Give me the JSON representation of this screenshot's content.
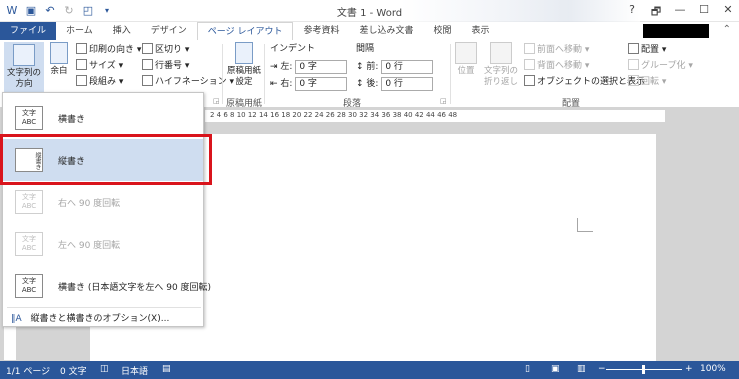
{
  "title": "文書 1 - Word",
  "qat": {
    "save": "保存",
    "undo": "元に戻す",
    "redo": "やり直し"
  },
  "window": {
    "help": "?",
    "restore": "🗗",
    "minimize": "—",
    "maximize": "☐",
    "close": "✕"
  },
  "tabs": [
    "ファイル",
    "ホーム",
    "挿入",
    "デザイン",
    "ページ レイアウト",
    "参考資料",
    "差し込み文書",
    "校閲",
    "表示"
  ],
  "ribbon": {
    "text_direction": "文字列の\n方向",
    "margins": "余白",
    "print_orientation": "印刷の向き",
    "size": "サイズ",
    "columns": "段組み",
    "breaks": "区切り",
    "line_numbers": "行番号",
    "hyphenation": "ハイフネーション",
    "manuscript": "原稿用紙\n設定",
    "manuscript_group": "原稿用紙",
    "indent_label": "インデント",
    "spacing_label": "間隔",
    "indent_left_label": "左:",
    "indent_left_value": "0 字",
    "indent_right_label": "右:",
    "indent_right_value": "0 字",
    "spacing_before_label": "前:",
    "spacing_before_value": "0 行",
    "spacing_after_label": "後:",
    "spacing_after_value": "0 行",
    "paragraph_group": "段落",
    "position": "位置",
    "wrap": "文字列の\n折り返し",
    "bring_forward": "前面へ移動",
    "send_backward": "背面へ移動",
    "selection_pane": "オブジェクトの選択と表示",
    "align": "配置",
    "group": "グループ化",
    "rotate": "回転",
    "arrange_group": "配置"
  },
  "ruler": "2   4   6   8   10  12  14  16  18  20  22  24  26  28  30  32  34  36  38  40  42  44  46  48",
  "menu": {
    "items": [
      {
        "icon": "文字\nABC",
        "label": "横書き"
      },
      {
        "icon": "縦書き",
        "label": "縦書き"
      },
      {
        "icon": "文字\nABC",
        "label": "右へ 90 度回転"
      },
      {
        "icon": "文字\nABC",
        "label": "左へ 90 度回転"
      },
      {
        "icon": "文字\nABC",
        "label": "横書き (日本語文字を左へ 90 度回転)"
      }
    ],
    "options": "縦書きと横書きのオプション(X)..."
  },
  "status": {
    "page": "1/1 ページ",
    "words": "0 文字",
    "language": "日本語",
    "zoom": "100%",
    "zoom_minus": "−",
    "zoom_plus": "+"
  }
}
